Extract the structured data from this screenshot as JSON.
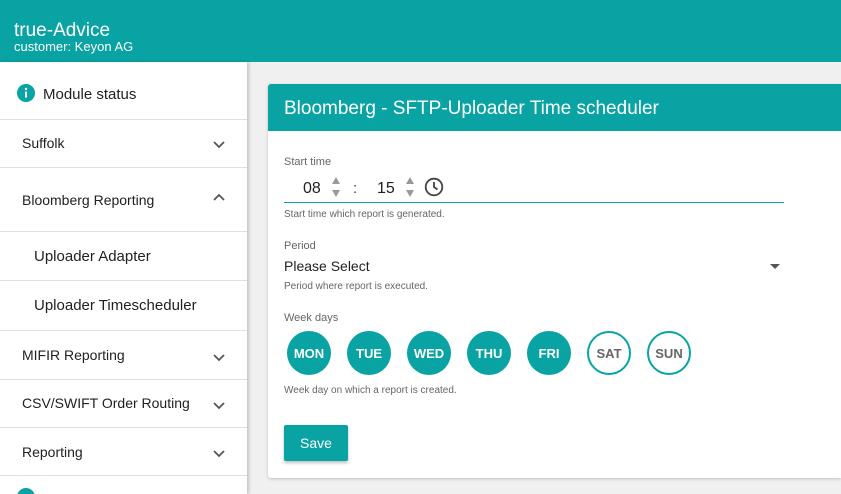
{
  "app": {
    "title": "true-Advice",
    "customer": "customer: Keyon AG"
  },
  "sidebar": {
    "module_status": "Module status",
    "items": [
      {
        "label": "Suffolk",
        "expanded": false
      },
      {
        "label": "Bloomberg Reporting",
        "expanded": true
      },
      {
        "label": "Uploader Adapter",
        "sub": true
      },
      {
        "label": "Uploader Timescheduler",
        "sub": true
      },
      {
        "label": "MIFIR Reporting",
        "expanded": false
      },
      {
        "label": "CSV/SWIFT Order Routing",
        "expanded": false
      },
      {
        "label": "Reporting",
        "expanded": false
      }
    ]
  },
  "panel": {
    "title": "Bloomberg - SFTP-Uploader Time scheduler",
    "start_time": {
      "label": "Start time",
      "hours": "08",
      "separator": ":",
      "minutes": "15",
      "hint": "Start time which report is generated."
    },
    "period": {
      "label": "Period",
      "value": "Please Select",
      "hint": "Period where report is executed."
    },
    "week_days": {
      "label": "Week days",
      "hint": "Week day on which a report is created.",
      "days": [
        {
          "label": "MON",
          "selected": true
        },
        {
          "label": "TUE",
          "selected": true
        },
        {
          "label": "WED",
          "selected": true
        },
        {
          "label": "THU",
          "selected": true
        },
        {
          "label": "FRI",
          "selected": true
        },
        {
          "label": "SAT",
          "selected": false
        },
        {
          "label": "SUN",
          "selected": false
        }
      ]
    },
    "save_label": "Save"
  },
  "colors": {
    "accent": "#0aa3a3",
    "text": "#212121",
    "hint": "#666666",
    "background": "#f0f0f0"
  }
}
